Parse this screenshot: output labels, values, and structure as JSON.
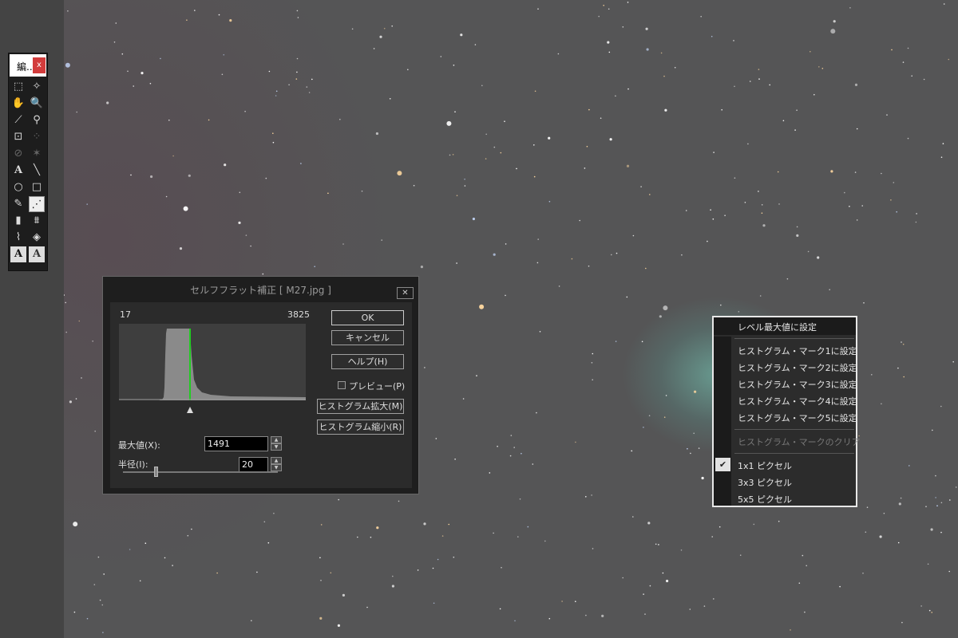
{
  "toolbox": {
    "title": "編..",
    "close": "x",
    "tools": [
      "select-rect",
      "auto-select",
      "hand",
      "zoom",
      "eyedropper",
      "color-picker",
      "crop",
      "extract",
      "eraser",
      "star-tool",
      "text",
      "line",
      "ellipse",
      "rectangle",
      "pencil",
      "self-flat",
      "level",
      "stamp",
      "curve",
      "perspective",
      "text-outline",
      "text-shadow"
    ]
  },
  "dialog": {
    "title": "セルフフラット補正 [ M27.jpg ]",
    "close": "✕",
    "hist_min": "17",
    "hist_max": "3825",
    "max_label": "最大値(X):",
    "max_value": "1491",
    "radius_label": "半径(I):",
    "radius_value": "20",
    "radius_slider_fraction": 0.2,
    "ok": "OK",
    "cancel": "キャンセル",
    "help": "ヘルプ(H)",
    "preview": "プレビュー(P)",
    "zoom_in": "ヒストグラム拡大(M)",
    "zoom_out": "ヒストグラム縮小(R)"
  },
  "menu": {
    "items": [
      "レベル最大値に設定",
      "ヒストグラム・マーク1に設定",
      "ヒストグラム・マーク2に設定",
      "ヒストグラム・マーク3に設定",
      "ヒストグラム・マーク4に設定",
      "ヒストグラム・マーク5に設定",
      "ヒストグラム・マークのクリア",
      "1x1 ピクセル",
      "3x3 ピクセル",
      "5x5 ピクセル"
    ],
    "checked": "1x1 ピクセル",
    "disabled": "ヒストグラム・マークのクリア"
  },
  "colors": {
    "histogram_fill": "#8a8a8a",
    "histogram_marker": "#22cc22",
    "nebula": "#78d2be"
  }
}
